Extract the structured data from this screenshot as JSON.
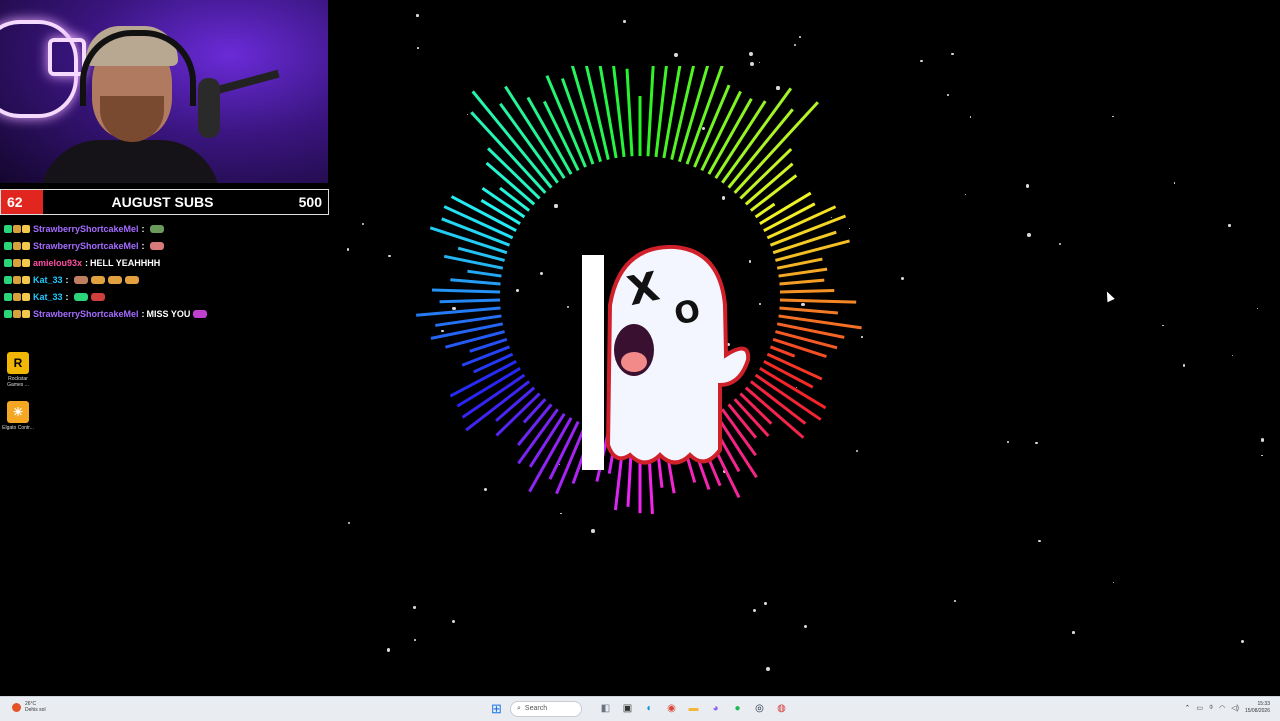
{
  "subgoal": {
    "current": "62",
    "title": "AUGUST SUBS",
    "target": "500"
  },
  "chat": [
    {
      "user": "StrawberryShortcakeMel",
      "user_color": "#a46bff",
      "message": "",
      "emotes": [
        "#6c9a5a"
      ]
    },
    {
      "user": "StrawberryShortcakeMel",
      "user_color": "#a46bff",
      "message": "",
      "emotes": [
        "#d87a7a"
      ]
    },
    {
      "user": "amielou93x",
      "user_color": "#ff4fa3",
      "message": "HELL YEAHHHH",
      "emotes": []
    },
    {
      "user": "Kat_33",
      "user_color": "#22c7ff",
      "message": "",
      "emotes": [
        "#c08060",
        "#e2a040",
        "#e2a040",
        "#e2a040"
      ]
    },
    {
      "user": "Kat_33",
      "user_color": "#22c7ff",
      "message": "",
      "emotes": [
        "#2bd67a",
        "#d0403a"
      ]
    },
    {
      "user": "StrawberryShortcakeMel",
      "user_color": "#a46bff",
      "message": "MISS YOU",
      "emotes": [
        "#c040d0"
      ]
    }
  ],
  "desktop_icons": [
    {
      "label": "Rockstar Games ...",
      "icon": "rockstar-icon",
      "glyph": "R",
      "color": "#f2b705"
    },
    {
      "label": "Elgato Contr...",
      "icon": "elgato-icon",
      "glyph": "☀",
      "color": "#f5a623"
    }
  ],
  "taskbar": {
    "weather": {
      "temp": "26°C",
      "desc": "Dehis sol"
    },
    "search_placeholder": "Search",
    "apps": [
      {
        "name": "start-icon",
        "glyph": "⊞",
        "color": "#1a73e8"
      },
      {
        "name": "widgets-icon",
        "glyph": "◧",
        "color": "#6b7280"
      },
      {
        "name": "taskview-icon",
        "glyph": "▣",
        "color": "#333333"
      },
      {
        "name": "edge-icon",
        "glyph": "◐",
        "color": "#0f8bd6"
      },
      {
        "name": "chrome-icon",
        "glyph": "◉",
        "color": "#db4437"
      },
      {
        "name": "explorer-icon",
        "glyph": "▬",
        "color": "#f3b83a"
      },
      {
        "name": "messenger-icon",
        "glyph": "◕",
        "color": "#8a5cf6"
      },
      {
        "name": "spotify-icon",
        "glyph": "●",
        "color": "#1db954"
      },
      {
        "name": "steam-icon",
        "glyph": "◎",
        "color": "#1b2838"
      },
      {
        "name": "obs-icon",
        "glyph": "◍",
        "color": "#d9302f"
      }
    ],
    "clock": {
      "time": "15:33",
      "date": "15/08/2026"
    }
  },
  "ghost": {
    "left_eye": "X",
    "right_eye": "O"
  }
}
